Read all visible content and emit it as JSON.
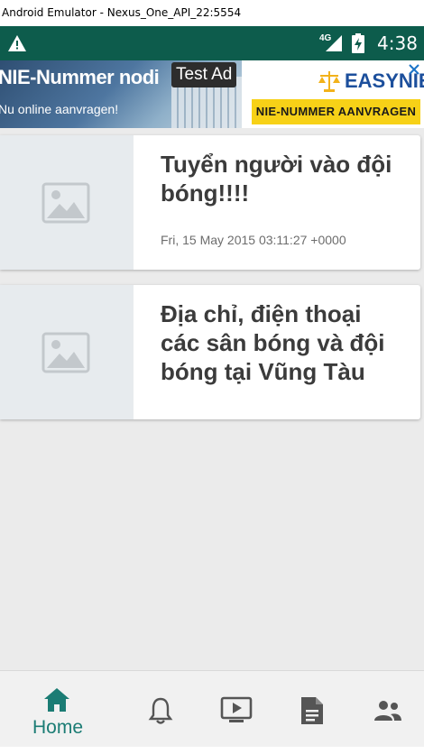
{
  "window": {
    "title": "Android Emulator - Nexus_One_API_22:5554"
  },
  "status_bar": {
    "network": "4G",
    "time": "4:38"
  },
  "ad": {
    "headline": "NIE-Nummer nodi",
    "subline": "Nu online aanvragen!",
    "badge": "Test Ad",
    "brand": "EASYNIE",
    "cta": "NIE-NUMMER AANVRAGEN"
  },
  "posts": [
    {
      "title": "Tuyển người vào đội bóng!!!!",
      "date": "Fri, 15 May 2015 03:11:27 +0000"
    },
    {
      "title": "Địa chỉ, điện thoại các sân bóng và đội bóng tại Vũng Tàu",
      "date": ""
    }
  ],
  "bottom_nav": {
    "active": "Home",
    "items": [
      {
        "icon": "home-icon",
        "label": "Home"
      },
      {
        "icon": "bell-icon",
        "label": ""
      },
      {
        "icon": "video-icon",
        "label": ""
      },
      {
        "icon": "document-icon",
        "label": ""
      },
      {
        "icon": "people-icon",
        "label": ""
      }
    ],
    "accent_color": "#1b7c74",
    "icon_color": "#555555"
  },
  "colors": {
    "status_bar": "#0d5c4c",
    "background": "#ebebeb",
    "ad_cta": "#f7d117"
  }
}
